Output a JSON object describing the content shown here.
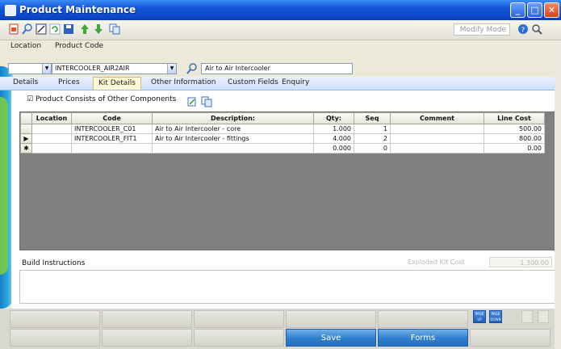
{
  "window": {
    "title": "Product Maintenance"
  },
  "toolbar": {
    "mode": "Modify Mode"
  },
  "header": {
    "location_label": "Location",
    "product_code_label": "Product Code",
    "product_code_value": "INTERCOOLER_AIR2AIR",
    "description_value": "Air to Air Intercooler"
  },
  "tabs": [
    {
      "label": "Details"
    },
    {
      "label": "Prices"
    },
    {
      "label": "Kit Details"
    },
    {
      "label": "Other Information"
    },
    {
      "label": "Custom Fields"
    },
    {
      "label": "Enquiry"
    }
  ],
  "kit": {
    "checkbox_label": "Product Consists of Other Components",
    "columns": [
      "Location",
      "Code",
      "Description:",
      "Qty:",
      "Seq",
      "Comment",
      "Line Cost"
    ],
    "rows": [
      {
        "location": "",
        "code": "INTERCOOLER_C01",
        "description": "Air to Air Intercooler - core",
        "qty": "1.000",
        "seq": "1",
        "comment": "",
        "line_cost": "500.00"
      },
      {
        "location": "",
        "code": "INTERCOOLER_FIT1",
        "description": "Air to Air Intercooler - fittings",
        "qty": "4.000",
        "seq": "2",
        "comment": "",
        "line_cost": "800.00"
      },
      {
        "location": "",
        "code": "",
        "description": "",
        "qty": "0.000",
        "seq": "0",
        "comment": "",
        "line_cost": "0.00"
      }
    ],
    "row_markers": [
      "",
      "▶",
      "✱"
    ]
  },
  "build": {
    "label": "Build Instructions",
    "exploded_label": "Exploded Kit Cost",
    "exploded_value": "1,300.00"
  },
  "function_keys": {
    "save_label": "Save",
    "forms_label": "Forms",
    "page_up": "PAGE UP",
    "page_down": "PAGE DOWN"
  },
  "colors": {
    "title_bar": "#0a46c8",
    "accent_blue": "#2f7fce",
    "tab_active": "#fff7d6"
  }
}
